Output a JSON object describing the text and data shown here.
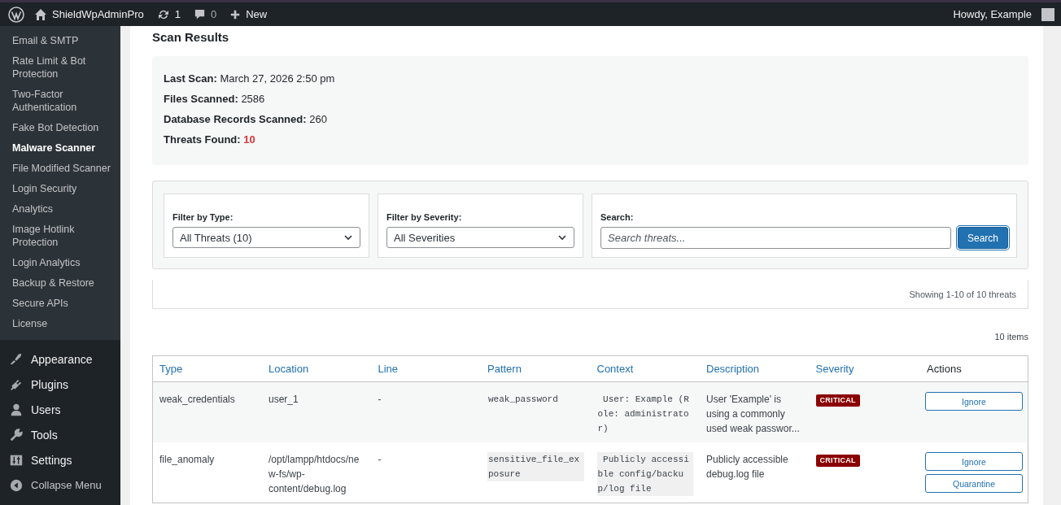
{
  "admin_bar": {
    "site_name": "ShieldWpAdminPro",
    "updates": "1",
    "comments": "0",
    "new_label": "New",
    "greeting": "Howdy, Example"
  },
  "sidebar": {
    "submenu": [
      {
        "label": "Email & SMTP",
        "selected": false
      },
      {
        "label": "Rate Limit & Bot Protection",
        "selected": false
      },
      {
        "label": "Two-Factor Authentication",
        "selected": false
      },
      {
        "label": "Fake Bot Detection",
        "selected": false
      },
      {
        "label": "Malware Scanner",
        "selected": true
      },
      {
        "label": "File Modified Scanner",
        "selected": false
      },
      {
        "label": "Login Security",
        "selected": false
      },
      {
        "label": "Analytics",
        "selected": false
      },
      {
        "label": "Image Hotlink Protection",
        "selected": false
      },
      {
        "label": "Login Analytics",
        "selected": false
      },
      {
        "label": "Backup & Restore",
        "selected": false
      },
      {
        "label": "Secure APIs",
        "selected": false
      },
      {
        "label": "License",
        "selected": false
      }
    ],
    "menu": [
      {
        "label": "Appearance",
        "kind": "brush"
      },
      {
        "label": "Plugins",
        "kind": "plug"
      },
      {
        "label": "Users",
        "kind": "user"
      },
      {
        "label": "Tools",
        "kind": "wrench"
      },
      {
        "label": "Settings",
        "kind": "sliders"
      }
    ],
    "collapse": "Collapse Menu"
  },
  "scan_results": {
    "title": "Scan Results",
    "summary": [
      {
        "label": "Last Scan:",
        "value": "March 27, 2026 2:50 pm",
        "alert": false
      },
      {
        "label": "Files Scanned:",
        "value": "2586",
        "alert": false
      },
      {
        "label": "Database Records Scanned:",
        "value": "260",
        "alert": false
      },
      {
        "label": "Threats Found:",
        "value": "10",
        "alert": true
      }
    ]
  },
  "filters": {
    "type": {
      "label": "Filter by Type:",
      "value": "All Threats (10)"
    },
    "severity": {
      "label": "Filter by Severity:",
      "value": "All Severities"
    },
    "search": {
      "label": "Search:",
      "placeholder": "Search threats...",
      "button": "Search"
    }
  },
  "showing": "Showing 1-10 of 10 threats",
  "item_count": "10 items",
  "table": {
    "columns": [
      {
        "label": "Type",
        "sortable": true,
        "kind": "text"
      },
      {
        "label": "Location",
        "sortable": true,
        "kind": "text"
      },
      {
        "label": "Line",
        "sortable": true,
        "kind": "text"
      },
      {
        "label": "Pattern",
        "sortable": true,
        "kind": "code"
      },
      {
        "label": "Context",
        "sortable": true,
        "kind": "code"
      },
      {
        "label": "Description",
        "sortable": true,
        "kind": "text"
      },
      {
        "label": "Severity",
        "sortable": true,
        "kind": "badge"
      },
      {
        "label": "Actions",
        "sortable": false,
        "kind": "actions"
      }
    ],
    "rows": [
      {
        "cells": [
          "weak_credentials",
          "user_1",
          "-",
          "weak_password",
          " User: Example (Role: administrator)",
          "User 'Example' is using a commonly used weak passwor...",
          {
            "label": "CRITICAL",
            "color": "#8a0000"
          },
          [
            "Ignore"
          ]
        ]
      },
      {
        "cells": [
          "file_anomaly",
          "/opt/lampp/htdocs/new-fs/wp-content/debug.log",
          "-",
          "sensitive_file_exposure",
          " Publicly accessible config/backup/log file",
          "Publicly accessible debug.log file",
          {
            "label": "CRITICAL",
            "color": "#8a0000"
          },
          [
            "Ignore",
            "Quarantine"
          ]
        ]
      }
    ]
  }
}
